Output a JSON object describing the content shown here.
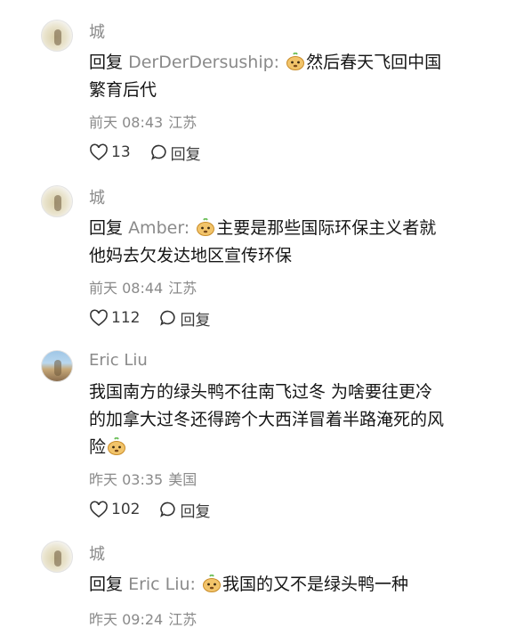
{
  "comments": [
    {
      "author": "城",
      "reply_prefix": "回复",
      "reply_target": "DerDerDersuship:",
      "text_line1": "然后春天飞回中国",
      "text_line2": "繁育后代",
      "time": "前天 08:43",
      "location": "江苏",
      "likes": "13",
      "reply_label": "回复",
      "avatar_icon": "avatar-image"
    },
    {
      "author": "城",
      "reply_prefix": "回复",
      "reply_target": "Amber:",
      "text_line1": "主要是那些国际环保主义者就",
      "text_line2": "他妈去欠发达地区宣传环保",
      "time": "前天 08:44",
      "location": "江苏",
      "likes": "112",
      "reply_label": "回复",
      "avatar_icon": "avatar-image"
    },
    {
      "author": "Eric Liu",
      "text_line1": "我国南方的绿头鸭不往南飞过冬 为啥要往更冷",
      "text_line2": "的加拿大过冬还得跨个大西洋冒着半路淹死的风",
      "text_line3": "险",
      "time": "昨天 03:35",
      "location": "美国",
      "likes": "102",
      "reply_label": "回复",
      "avatar_icon": "avatar-image"
    },
    {
      "author": "城",
      "reply_prefix": "回复",
      "reply_target": "Eric Liu:",
      "text_line1": "我国的又不是绿头鸭一种",
      "time": "昨天 09:24",
      "location": "江苏",
      "avatar_icon": "avatar-image"
    }
  ],
  "icons": {
    "like": "heart-icon",
    "reply": "speech-bubble-icon",
    "emoji": "dog-face-emoji-icon"
  },
  "colors": {
    "text": "#151515",
    "secondary": "#8a8a8a",
    "emoji_face": "#f2c46a",
    "emoji_leaf": "#6bbf59"
  }
}
